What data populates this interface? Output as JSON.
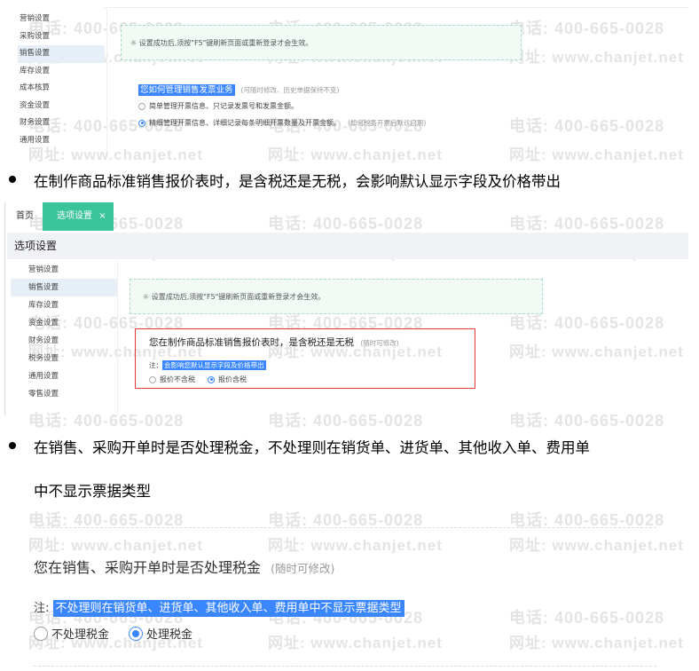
{
  "watermark": {
    "phone": "电话: 400-665-0028",
    "site": "网址: www.chanjet.net"
  },
  "shot1": {
    "sidebar": [
      "营销设置",
      "采购设置",
      "销售设置",
      "库存设置",
      "成本核算",
      "资金设置",
      "财务设置",
      "通用设置"
    ],
    "notice": "设置成功后,须按\"F5\"键刷新页面或重新登录才会生效。",
    "question": "您如何管理销售发票业务",
    "question_hint": "(可随时修改、历史单据保持不变)",
    "options": [
      {
        "label": "简单管理开票信息、只记录发票号和发票金额。",
        "hint": "",
        "selected": false
      },
      {
        "label": "精细管理开票信息、详细记录每条明细开票数量及开票金额。",
        "hint": "(如何税务开票后默认启用)",
        "selected": true
      }
    ]
  },
  "bullets": [
    {
      "text": "在制作商品标准销售报价表时，是含税还是无税，会影响默认显示字段及价格带出"
    },
    {
      "text": "在销售、采购开单时是否处理税金，不处理则在销货单、进货单、其他收入单、费用单",
      "cont": "中不显示票据类型"
    }
  ],
  "shot2": {
    "tabs": {
      "home": "首页",
      "active": "选项设置",
      "close": "×"
    },
    "page_title": "选项设置",
    "sidebar": [
      "营销设置",
      "销售设置",
      "库存设置",
      "资金设置",
      "财务设置",
      "税务设置",
      "通用设置",
      "零售设置"
    ],
    "notice": "设置成功后,须按\"F5\"键刷新页面或重新登录才会生效。",
    "question": "您在制作商品标准销售报价表时，是含税还是无税",
    "question_hint": "(随时可修改)",
    "note_prefix": "注：",
    "note": "会影响您默认显示字段及价格带出",
    "options": [
      {
        "label": "报价不含税",
        "selected": false
      },
      {
        "label": "报价含税",
        "selected": true
      }
    ]
  },
  "shot3": {
    "question": "您在销售、采购开单时是否处理税金",
    "question_hint": "(随时可修改)",
    "note_prefix": "注:",
    "note": "不处理则在销货单、进货单、其他收入单、费用单中不显示票据类型",
    "options": [
      {
        "label": "不处理税金",
        "selected": false
      },
      {
        "label": "处理税金",
        "selected": true
      }
    ]
  },
  "colors": {
    "accent": "#3a86ff",
    "tab_active": "#3bc49a",
    "red_box": "#e53935",
    "notice_bg": "#f2faf5"
  }
}
